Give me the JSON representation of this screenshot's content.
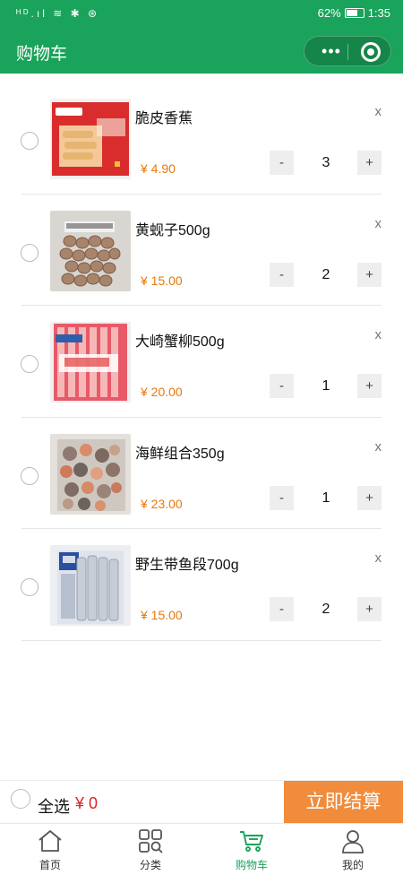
{
  "status_bar": {
    "signal": "ᴴᴰ .ıl ≋ ✱ ⊛",
    "battery": "62%",
    "time": "1:35"
  },
  "header": {
    "title": "购物车",
    "menu_dots": "•••"
  },
  "items": [
    {
      "name": "脆皮香蕉",
      "price": "¥ 4.90",
      "qty": "3",
      "image_icon": "banana-snack-package"
    },
    {
      "name": "黄蚬子500g",
      "price": "¥ 15.00",
      "qty": "2",
      "image_icon": "clams-bag"
    },
    {
      "name": "大崎蟹柳500g",
      "price": "¥ 20.00",
      "qty": "1",
      "image_icon": "crab-stick-package"
    },
    {
      "name": "海鲜组合350g",
      "price": "¥ 23.00",
      "qty": "1",
      "image_icon": "seafood-mix-bag"
    },
    {
      "name": "野生带鱼段700g",
      "price": "¥ 15.00",
      "qty": "2",
      "image_icon": "hairtail-fish-bag"
    }
  ],
  "stepper": {
    "minus": "-",
    "plus": "+"
  },
  "delete_label": "x",
  "checkout": {
    "select_all": "全选",
    "total": "¥ 0",
    "button": "立即结算"
  },
  "tabs": [
    {
      "label": "首页",
      "icon": "home-icon"
    },
    {
      "label": "分类",
      "icon": "category-icon"
    },
    {
      "label": "购物车",
      "icon": "cart-icon"
    },
    {
      "label": "我的",
      "icon": "user-icon"
    }
  ],
  "colors": {
    "primary": "#1aa35a",
    "price": "#e8780b",
    "checkout_button": "#f08c3c",
    "total": "#e02020"
  }
}
